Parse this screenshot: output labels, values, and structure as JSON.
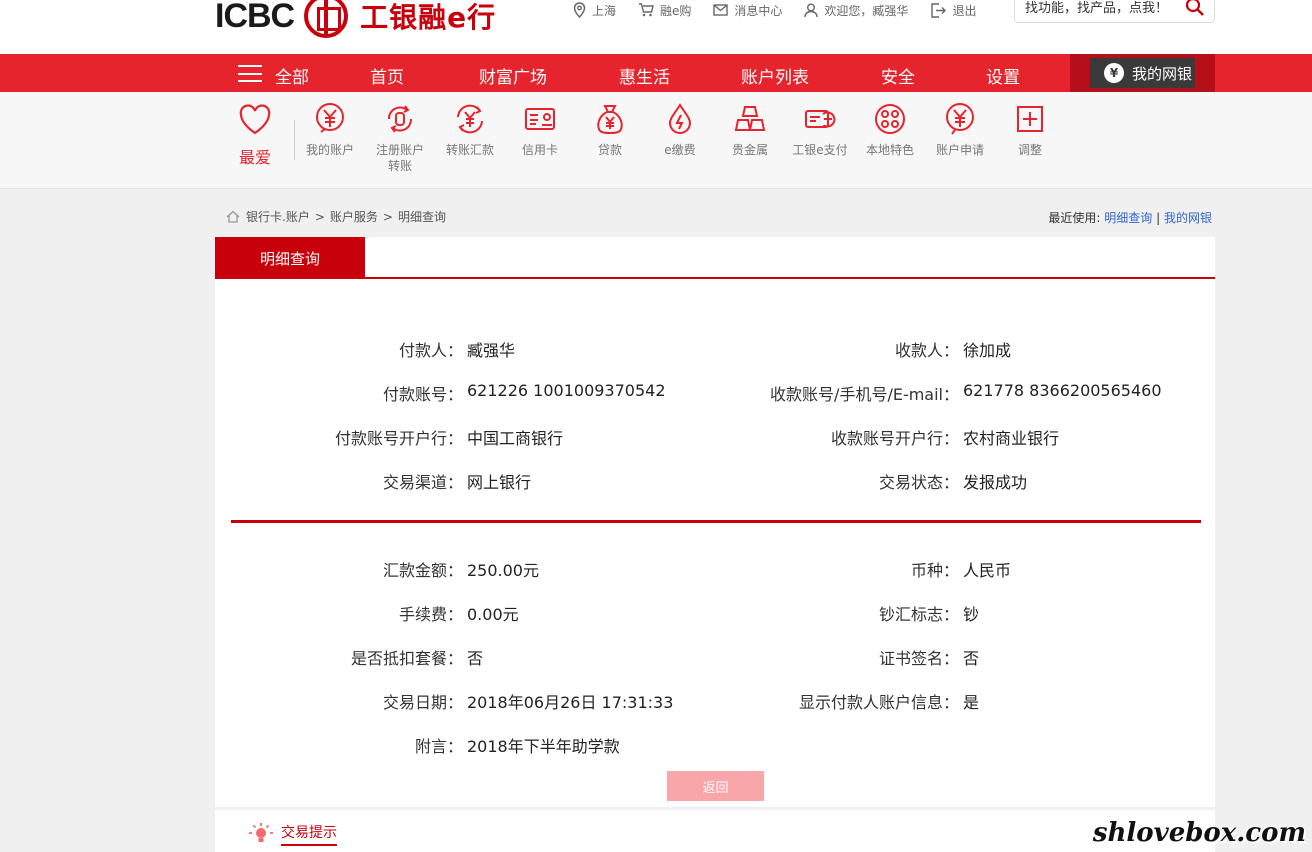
{
  "header": {
    "logo_text": "ICBC",
    "logo_cn": "工银融e行",
    "links": [
      {
        "label": "上海",
        "icon": "location-icon"
      },
      {
        "label": "融e购",
        "icon": "cart-icon"
      },
      {
        "label": "消息中心",
        "icon": "mail-icon"
      },
      {
        "label": "欢迎您，臧强华",
        "icon": "user-icon"
      },
      {
        "label": "退出",
        "icon": "logout-icon"
      }
    ],
    "search_placeholder": "找功能，找产品，点我！"
  },
  "nav": {
    "all": "全部",
    "items": [
      "首页",
      "财富广场",
      "惠生活",
      "账户列表",
      "安全",
      "设置"
    ],
    "mybank": "我的网银"
  },
  "quick": {
    "favorite": "最爱",
    "items": [
      {
        "label": "我的账户",
        "icon": "yen-coin-icon"
      },
      {
        "label": "注册账户转账",
        "icon": "register-transfer-icon"
      },
      {
        "label": "转账汇款",
        "icon": "transfer-icon"
      },
      {
        "label": "信用卡",
        "icon": "credit-card-icon"
      },
      {
        "label": "贷款",
        "icon": "money-bag-icon"
      },
      {
        "label": "e缴费",
        "icon": "drop-icon"
      },
      {
        "label": "贵金属",
        "icon": "gold-bars-icon"
      },
      {
        "label": "工银e支付",
        "icon": "e-pay-icon"
      },
      {
        "label": "本地特色",
        "icon": "local-icon"
      },
      {
        "label": "账户申请",
        "icon": "account-apply-icon"
      },
      {
        "label": "调整",
        "icon": "plus-box-icon"
      }
    ]
  },
  "breadcrumb": [
    "银行卡.账户",
    "账户服务",
    "明细查询"
  ],
  "recent": {
    "label": "最近使用:",
    "links": [
      "明细查询",
      "我的网银"
    ],
    "sep": "|"
  },
  "tab": "明细查询",
  "details": {
    "left": [
      {
        "label": "付款人：",
        "value": "臧强华"
      },
      {
        "label": "付款账号：",
        "value": "621226 1001009370542"
      },
      {
        "label": "付款账号开户行：",
        "value": "中国工商银行"
      },
      {
        "label": "交易渠道：",
        "value": "网上银行"
      }
    ],
    "right": [
      {
        "label": "收款人：",
        "value": "徐加成"
      },
      {
        "label": "收款账号/手机号/E-mail：",
        "value": "621778 8366200565460"
      },
      {
        "label": "收款账号开户行：",
        "value": "农村商业银行"
      },
      {
        "label": "交易状态：",
        "value": "发报成功"
      }
    ],
    "left2": [
      {
        "label": "汇款金额：",
        "value": "250.00元"
      },
      {
        "label": "手续费：",
        "value": "0.00元"
      },
      {
        "label": "是否抵扣套餐：",
        "value": "否"
      },
      {
        "label": "交易日期：",
        "value": "2018年06月26日 17:31:33"
      },
      {
        "label": "附言：",
        "value": "2018年下半年助学款"
      }
    ],
    "right2": [
      {
        "label": "币种：",
        "value": "人民币"
      },
      {
        "label": "钞汇标志：",
        "value": "钞"
      },
      {
        "label": "证书签名：",
        "value": "否"
      },
      {
        "label": "显示付款人账户信息：",
        "value": "是"
      }
    ]
  },
  "back_button": "返回",
  "tips": "交易提示",
  "watermark": "shlovebox.com",
  "colors": {
    "brand_red": "#e5242d",
    "dark_red": "#c7000b"
  }
}
